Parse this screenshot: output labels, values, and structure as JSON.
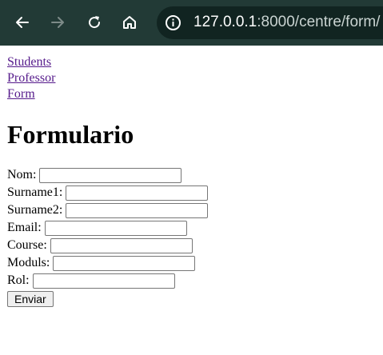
{
  "browser": {
    "url_host": "127.0.0.1",
    "url_rest": ":8000/centre/form/"
  },
  "nav": {
    "links": [
      "Students",
      "Professor",
      "Form"
    ]
  },
  "page": {
    "title": "Formulario"
  },
  "form": {
    "fields": [
      {
        "label": "Nom:",
        "value": ""
      },
      {
        "label": "Surname1:",
        "value": ""
      },
      {
        "label": "Surname2:",
        "value": ""
      },
      {
        "label": "Email:",
        "value": ""
      },
      {
        "label": "Course:",
        "value": ""
      },
      {
        "label": "Moduls:",
        "value": ""
      },
      {
        "label": "Rol:",
        "value": ""
      }
    ],
    "submit_label": "Enviar"
  }
}
